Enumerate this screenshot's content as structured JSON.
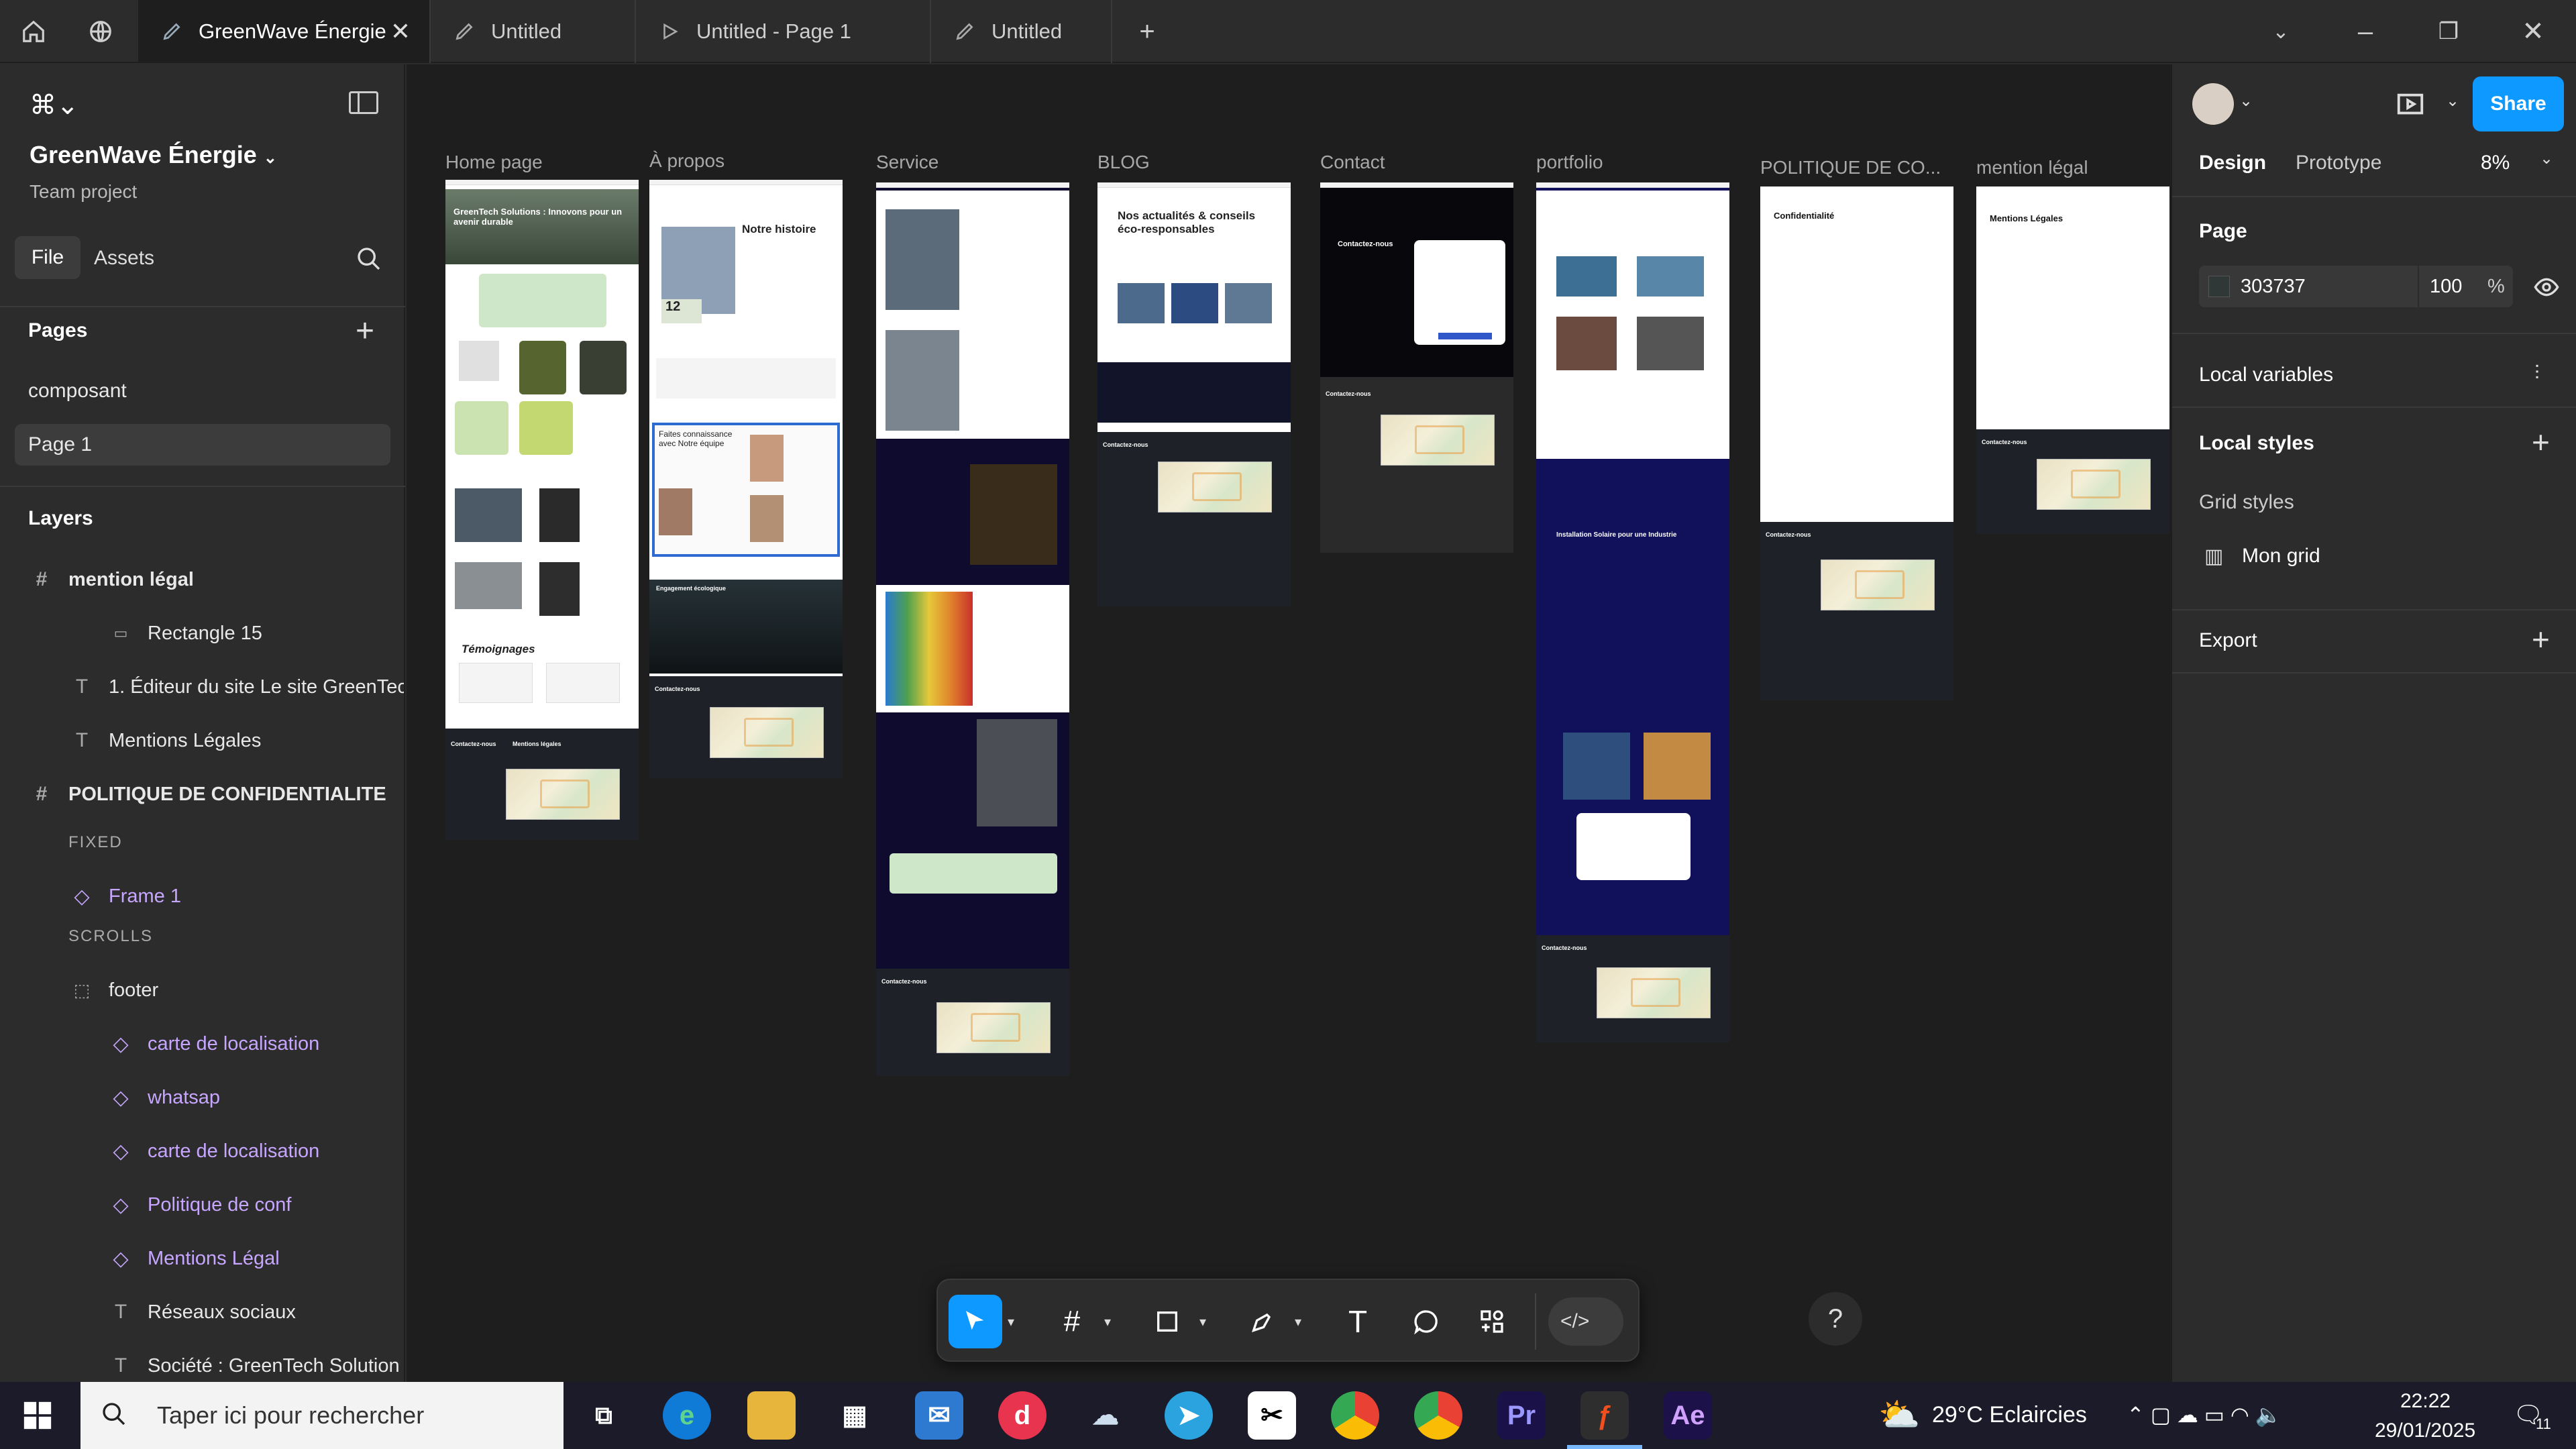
{
  "tabs": [
    {
      "label": "GreenWave Énergie",
      "active": true
    },
    {
      "label": "Untitled"
    },
    {
      "label": "Untitled - Page 1"
    },
    {
      "label": "Untitled"
    }
  ],
  "project": {
    "name": "GreenWave Énergie",
    "subtitle": "Team project"
  },
  "left_tabs": {
    "file": "File",
    "assets": "Assets"
  },
  "pages": {
    "heading": "Pages",
    "items": [
      "composant",
      "Page 1"
    ],
    "selected": "Page 1"
  },
  "layers": {
    "heading": "Layers",
    "items": [
      {
        "label": "mention légal",
        "type": "frame",
        "bold": true
      },
      {
        "label": "Rectangle 15",
        "type": "rect"
      },
      {
        "label": "1. Éditeur du site Le site GreenTec",
        "type": "text"
      },
      {
        "label": "Mentions Légales",
        "type": "text"
      },
      {
        "label": "POLITIQUE DE CONFIDENTIALITE",
        "type": "frame",
        "bold": true
      },
      {
        "label": "FIXED",
        "type": "section"
      },
      {
        "label": "Frame 1",
        "type": "component"
      },
      {
        "label": "SCROLLS",
        "type": "section"
      },
      {
        "label": "footer",
        "type": "group"
      },
      {
        "label": "carte de localisation",
        "type": "component"
      },
      {
        "label": "whatsap",
        "type": "component"
      },
      {
        "label": "carte de localisation",
        "type": "component"
      },
      {
        "label": "Politique de conf",
        "type": "component"
      },
      {
        "label": "Mentions Légal",
        "type": "component"
      },
      {
        "label": "Réseaux sociaux",
        "type": "text"
      },
      {
        "label": "Société : GreenTech Solution",
        "type": "text"
      }
    ]
  },
  "right": {
    "share": "Share",
    "design": "Design",
    "prototype": "Prototype",
    "zoom": "8%",
    "page_heading": "Page",
    "page_color": "303737",
    "page_opacity": "100",
    "percent": "%",
    "local_variables": "Local variables",
    "local_styles": "Local styles",
    "grid_styles": "Grid styles",
    "grid_item": "Mon grid",
    "export": "Export"
  },
  "frames": [
    {
      "label": "Home page",
      "hero": "GreenTech Solutions : Innovons pour un avenir durable",
      "section": "Témoignages"
    },
    {
      "label": "À propos",
      "hero": "Notre histoire",
      "badge": "12",
      "team": "Faites connaissance avec Notre équipe",
      "section": "Engagement écologique"
    },
    {
      "label": "Service"
    },
    {
      "label": "BLOG",
      "hero": "Nos actualités & conseils éco-responsables"
    },
    {
      "label": "Contact",
      "hero": "Contactez-nous"
    },
    {
      "label": "portfolio",
      "section": "Installation Solaire pour une Industrie"
    },
    {
      "label": "POLITIQUE DE CO...",
      "hero": "Confidentialité"
    },
    {
      "label": "mention légal",
      "hero": "Mentions Légales"
    }
  ],
  "footer_text": {
    "contact": "Contactez-nous",
    "mentions": "Mentions légales",
    "policy": "Politique de confidentialité",
    "social": "Réseaux sociaux"
  },
  "taskbar": {
    "search": "Taper ici pour rechercher",
    "weather": "29°C  Eclaircies",
    "time": "22:22",
    "date": "29/01/2025",
    "notif": "11"
  },
  "colors": {
    "accent": "#0d99ff",
    "canvas": "#1e1e1e",
    "panel": "#2c2c2c",
    "component": "#c7a6ff"
  }
}
